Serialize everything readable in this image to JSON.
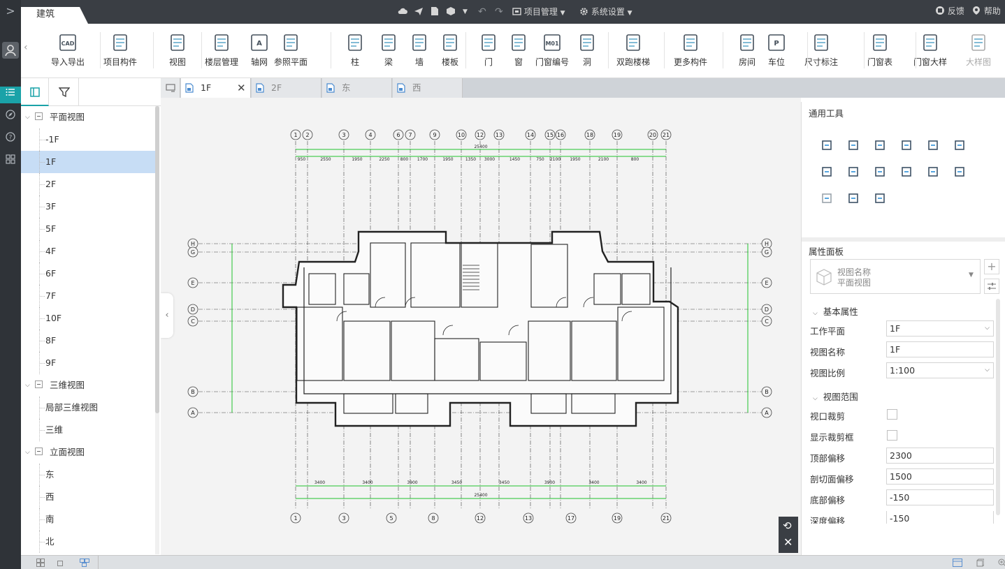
{
  "title_tab": "建筑",
  "header": {
    "project_menu": "项目管理",
    "settings_menu": "系统设置",
    "feedback": "反馈",
    "help": "帮助"
  },
  "toolbar": [
    {
      "label": "导入导出",
      "icon": "cad-import-icon",
      "badge": "CAD"
    },
    {
      "label": "项目构件",
      "icon": "project-component-icon"
    },
    {
      "label": "视图",
      "icon": "view-icon"
    },
    {
      "label": "楼层管理",
      "icon": "floor-manage-icon"
    },
    {
      "label": "轴网",
      "icon": "axis-grid-icon",
      "badge": "A"
    },
    {
      "label": "参照平面",
      "icon": "reference-plane-icon"
    },
    {
      "label": "柱",
      "icon": "column-icon"
    },
    {
      "label": "梁",
      "icon": "beam-icon"
    },
    {
      "label": "墙",
      "icon": "wall-icon"
    },
    {
      "label": "楼板",
      "icon": "slab-icon"
    },
    {
      "label": "门",
      "icon": "door-icon"
    },
    {
      "label": "窗",
      "icon": "window-icon"
    },
    {
      "label": "门窗编号",
      "icon": "door-window-tag-icon",
      "badge": "M01"
    },
    {
      "label": "洞",
      "icon": "opening-icon"
    },
    {
      "label": "双跑楼梯",
      "icon": "double-stair-icon"
    },
    {
      "label": "更多构件",
      "icon": "more-components-icon"
    },
    {
      "label": "房间",
      "icon": "room-icon"
    },
    {
      "label": "车位",
      "icon": "parking-icon",
      "badge": "P"
    },
    {
      "label": "尺寸标注",
      "icon": "dimension-icon"
    },
    {
      "label": "门窗表",
      "icon": "door-window-table-icon"
    },
    {
      "label": "门窗大样",
      "icon": "door-window-detail-icon"
    },
    {
      "label": "大样图",
      "icon": "detail-drawing-icon"
    }
  ],
  "tree": {
    "groups": [
      {
        "label": "平面视图",
        "items": [
          "-1F",
          "1F",
          "2F",
          "3F",
          "5F",
          "4F",
          "6F",
          "7F",
          "10F",
          "8F",
          "9F"
        ]
      },
      {
        "label": "三维视图",
        "items": [
          "局部三维视图",
          "三维"
        ]
      },
      {
        "label": "立面视图",
        "items": [
          "东",
          "西",
          "南",
          "北"
        ]
      }
    ],
    "selected": "1F"
  },
  "view_tabs": [
    "1F",
    "2F",
    "东",
    "西"
  ],
  "active_view_tab": "1F",
  "drawing": {
    "axes_top": [
      "1",
      "2",
      "3",
      "4",
      "6",
      "7",
      "9",
      "10",
      "12",
      "13",
      "14",
      "15",
      "16",
      "18",
      "19",
      "20",
      "21"
    ],
    "axes_bottom": [
      "1",
      "3",
      "5",
      "8",
      "12",
      "13",
      "17",
      "19",
      "21"
    ],
    "axes_left": [
      "H",
      "G",
      "E",
      "D",
      "C",
      "B",
      "A"
    ],
    "axes_right": [
      "H",
      "G",
      "E",
      "D",
      "C",
      "B",
      "A"
    ],
    "dims_top": [
      "950",
      "2550",
      "1950",
      "2250",
      "800",
      "1700",
      "1950",
      "1350",
      "3000",
      "1450",
      "750",
      "2100",
      "1950",
      "2100",
      "800"
    ],
    "total_top": "25400",
    "dims_bottom": [
      "3400",
      "3400",
      "3900",
      "3450",
      "3450",
      "3900",
      "3400",
      "3400"
    ],
    "total_bottom": "25400"
  },
  "tools_panel": {
    "title": "通用工具"
  },
  "props": {
    "title": "属性面板",
    "view_name_label": "视图名称",
    "view_name_value": "平面视图",
    "section_basic": "基本属性",
    "work_plane_label": "工作平面",
    "work_plane_value": "1F",
    "name_label": "视图名称",
    "name_value": "1F",
    "scale_label": "视图比例",
    "scale_value": "1:100",
    "section_range": "视图范围",
    "crop_label": "视口裁剪",
    "show_crop_label": "显示裁剪框",
    "top_offset_label": "顶部偏移",
    "top_offset_value": "2300",
    "cut_offset_label": "剖切面偏移",
    "cut_offset_value": "1500",
    "bottom_offset_label": "底部偏移",
    "bottom_offset_value": "-150",
    "depth_offset_label": "深度偏移",
    "depth_offset_value": "-150"
  },
  "colors": {
    "accent": "#1aa2a8",
    "green_dim": "#22c32e",
    "sidebar": "#2f3338",
    "titlebar": "#3a3e44"
  }
}
